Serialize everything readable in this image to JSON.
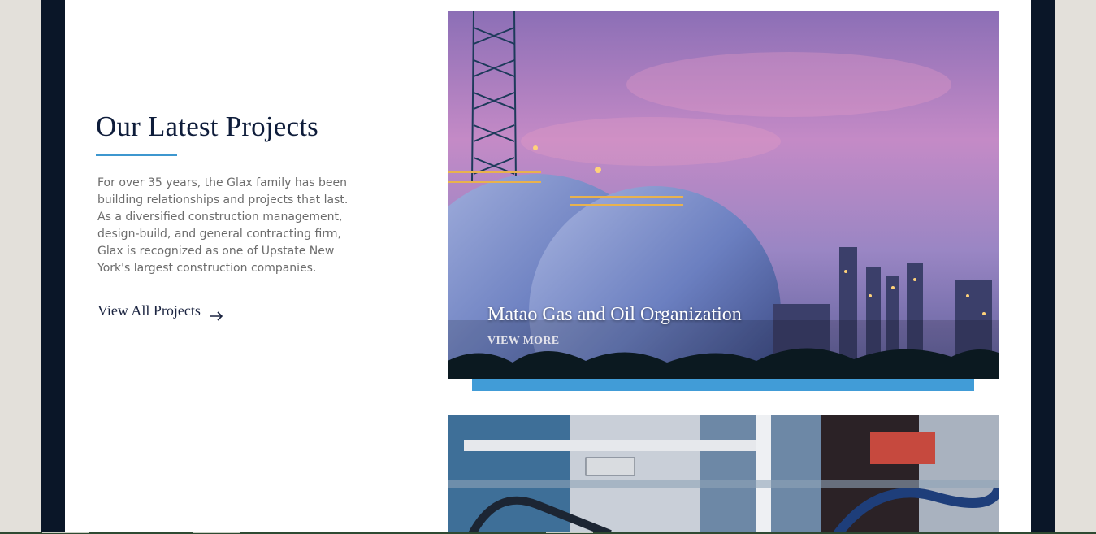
{
  "section": {
    "heading": "Our Latest Projects",
    "intro": "For over 35 years, the Glax family has been building relationships and projects that last. As a diversified construction management, design-build, and general contracting firm, Glax is recognized as one of Upstate New York's largest construction companies.",
    "view_all_label": "View All Projects",
    "view_all_icon": "arrow-right-icon"
  },
  "projects": [
    {
      "title": "Matao Gas and Oil Organization",
      "cta": "VIEW MORE"
    }
  ],
  "colors": {
    "frame": "#0a1628",
    "accent_blue": "#419cd7",
    "heading": "#0e1c3a",
    "body_text": "#6c6c6c"
  }
}
